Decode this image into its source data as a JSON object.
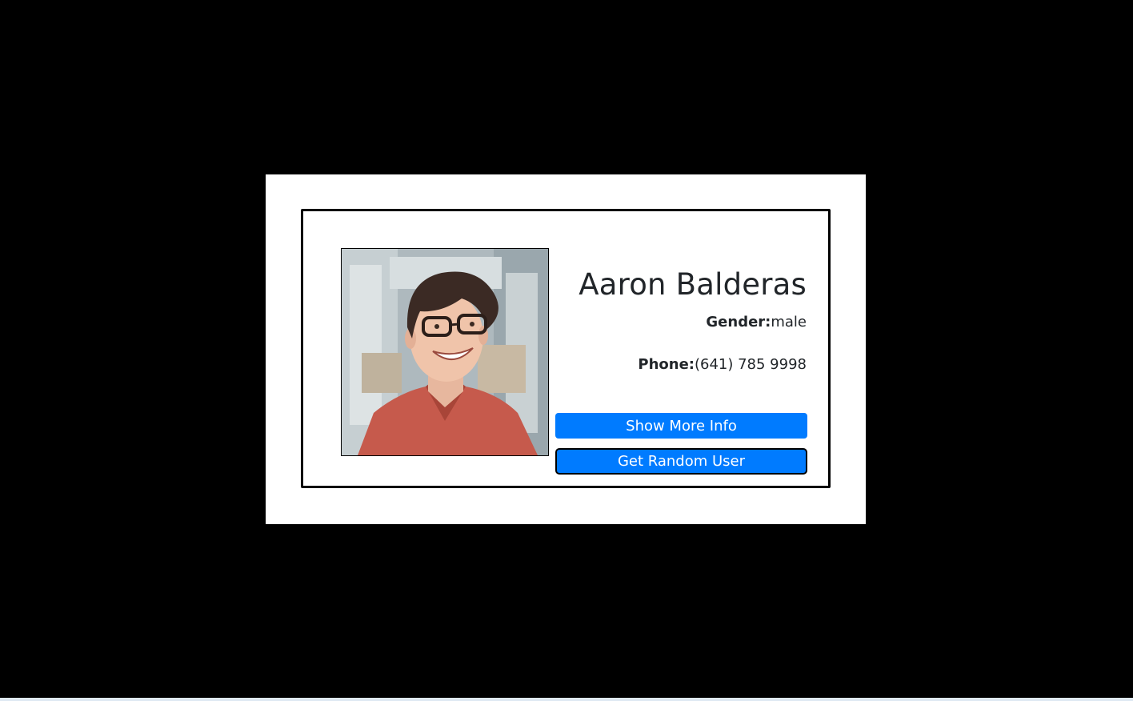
{
  "user": {
    "name": "Aaron Balderas",
    "gender_label": "Gender:",
    "gender_value": "male",
    "phone_label": "Phone:",
    "phone_value": "(641) 785 9998",
    "photo_alt": "user-photo"
  },
  "buttons": {
    "show_more": "Show More Info",
    "random_user": "Get Random User"
  },
  "colors": {
    "button_primary": "#007bff",
    "page_background": "#000000",
    "panel_background": "#ffffff",
    "text_dark": "#212529"
  }
}
